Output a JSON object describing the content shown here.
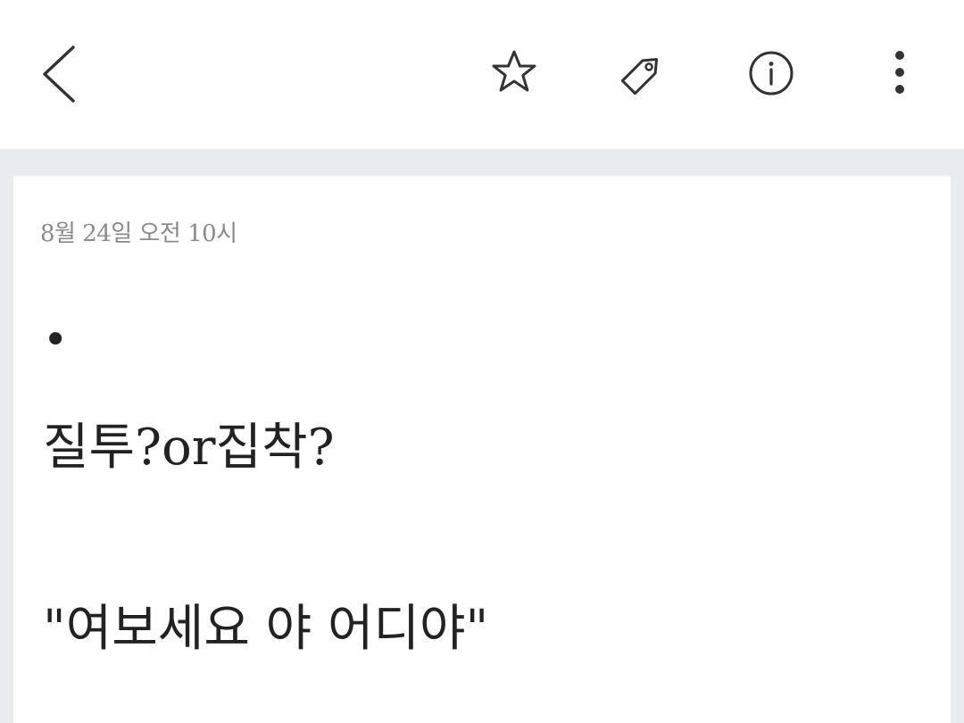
{
  "toolbar": {
    "icons": {
      "back": "chevron-left-icon",
      "favorite": "star-outline-icon",
      "tag": "tag-icon",
      "info": "info-circle-icon",
      "more": "more-vertical-icon"
    }
  },
  "note": {
    "date": "8월 24일 오전 10시",
    "lines": [
      "•",
      "질투?or집착?",
      "\"여보세요 야 어디야\""
    ]
  },
  "colors": {
    "background": "#e8ebef",
    "surface": "#ffffff",
    "text": "#222222",
    "meta_text": "#8a8a8a",
    "icon": "#333333"
  }
}
